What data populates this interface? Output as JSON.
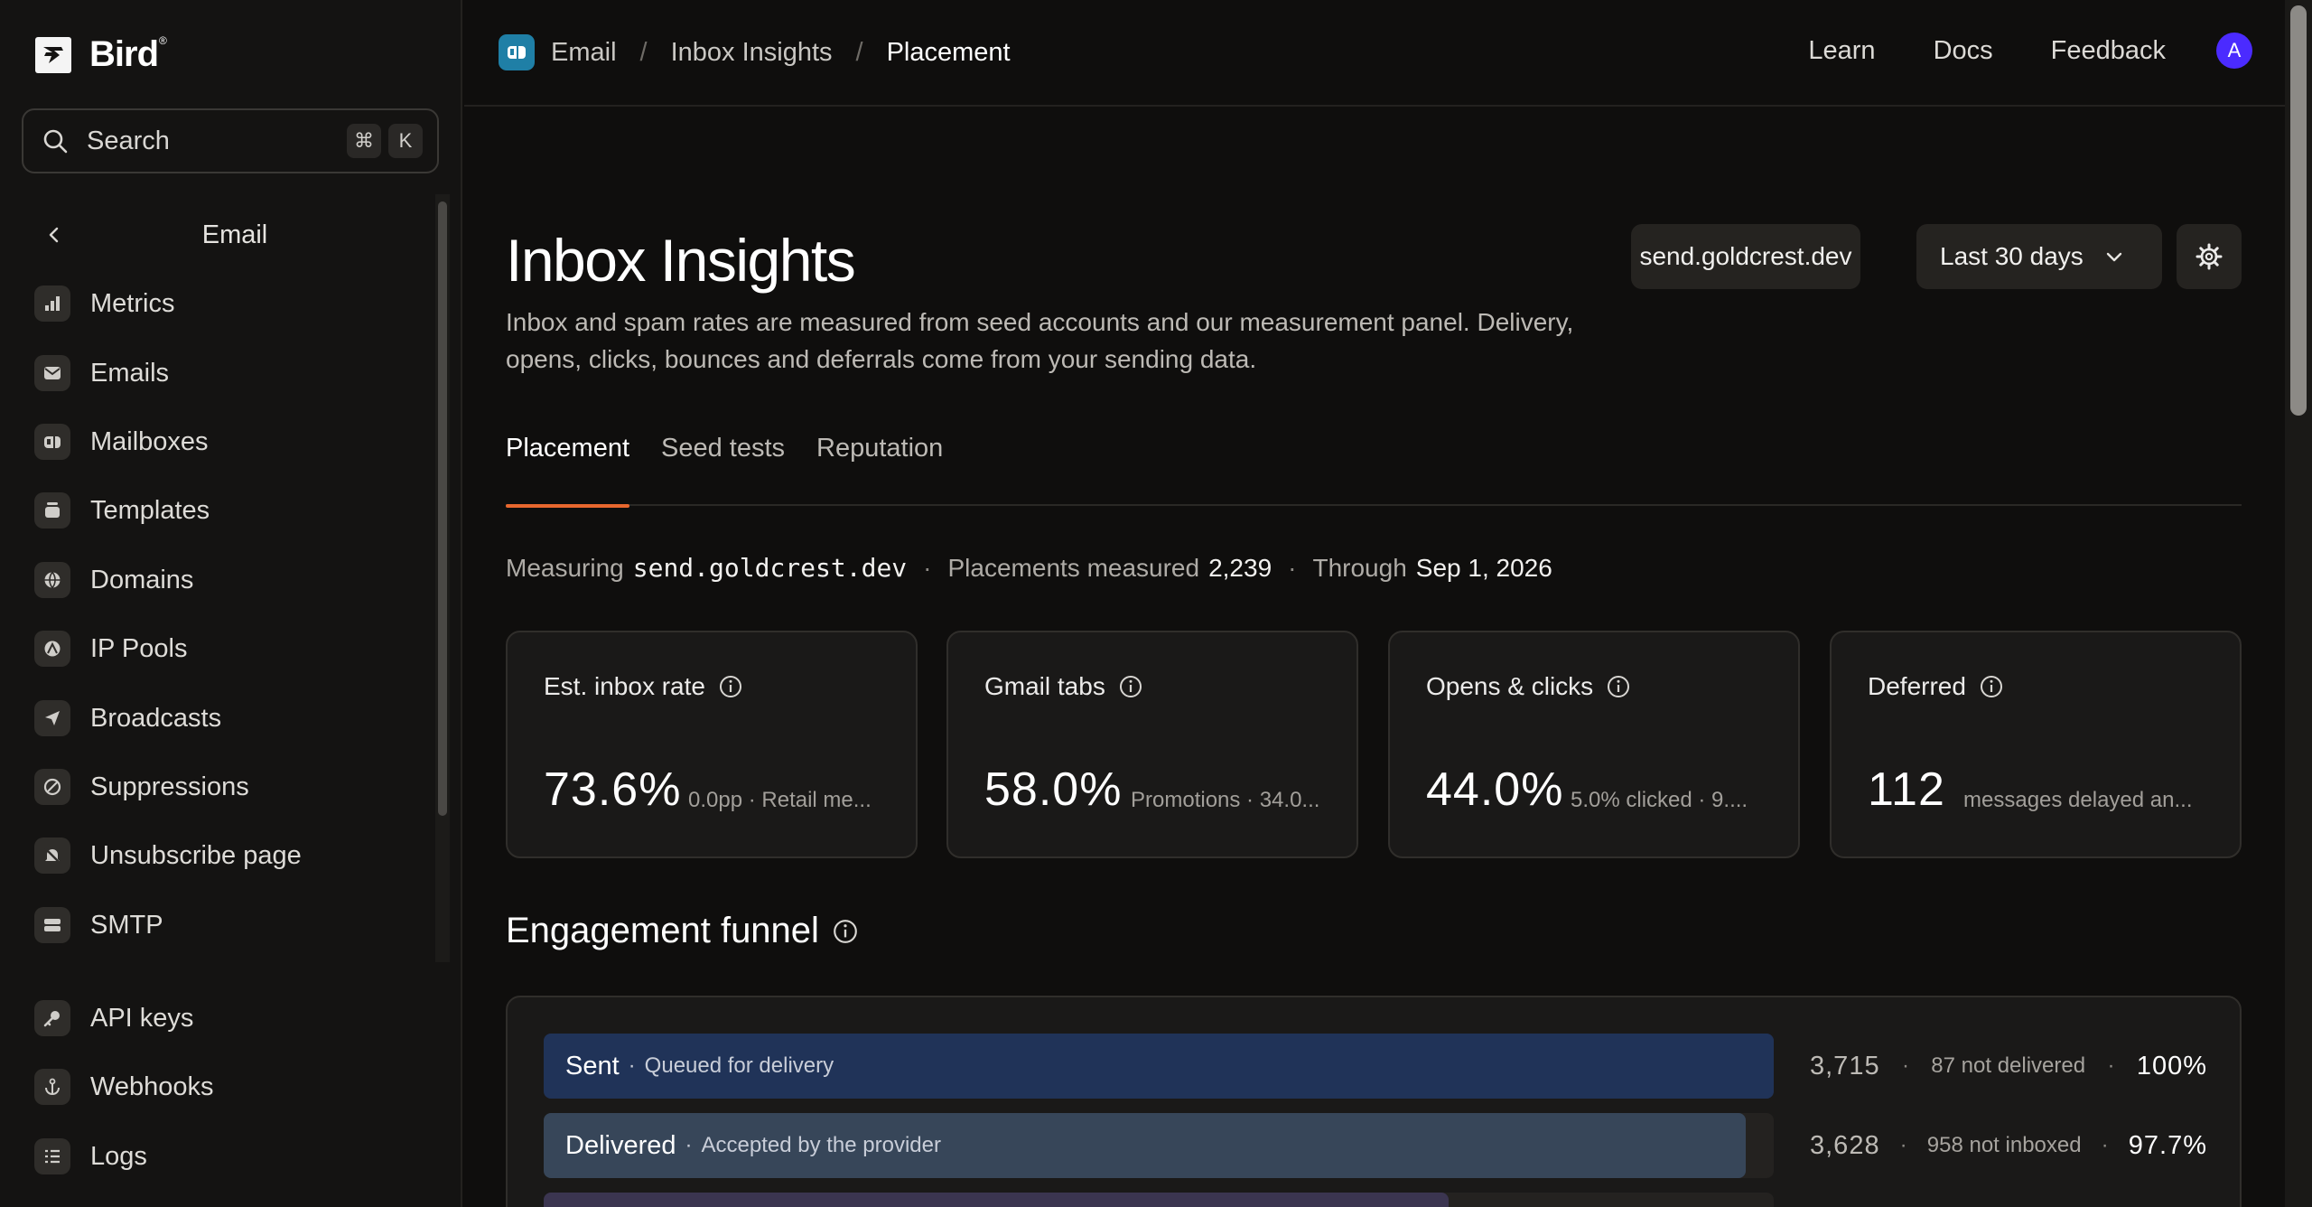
{
  "brand": {
    "name": "Bird",
    "mark": "®"
  },
  "search": {
    "label": "Search",
    "shortcut_mod": "⌘",
    "shortcut_key": "K"
  },
  "sidebar": {
    "back_label": "Email",
    "items": [
      {
        "label": "Metrics",
        "icon": "bar-chart-icon"
      },
      {
        "label": "Emails",
        "icon": "envelope-icon"
      },
      {
        "label": "Mailboxes",
        "icon": "mailbox-icon"
      },
      {
        "label": "Templates",
        "icon": "template-icon"
      },
      {
        "label": "Domains",
        "icon": "globe-icon"
      },
      {
        "label": "IP Pools",
        "icon": "ip-pool-icon"
      },
      {
        "label": "Broadcasts",
        "icon": "send-icon"
      },
      {
        "label": "Suppressions",
        "icon": "block-icon"
      },
      {
        "label": "Unsubscribe page",
        "icon": "bell-off-icon"
      },
      {
        "label": "SMTP",
        "icon": "server-icon"
      },
      {
        "label": "API keys",
        "icon": "key-icon"
      },
      {
        "label": "Webhooks",
        "icon": "anchor-icon"
      },
      {
        "label": "Logs",
        "icon": "list-icon"
      }
    ]
  },
  "breadcrumb": {
    "app": "Email",
    "section": "Inbox Insights",
    "current": "Placement",
    "separator": "/"
  },
  "topnav": {
    "learn": "Learn",
    "docs": "Docs",
    "feedback": "Feedback",
    "avatar_initial": "A"
  },
  "page": {
    "title": "Inbox Insights",
    "description": "Inbox and spam rates are measured from seed accounts and our measurement panel. Delivery, opens, clicks, bounces and deferrals come from your sending data.",
    "domain_selector": "send.goldcrest.dev",
    "date_range": "Last 30 days"
  },
  "tabs": [
    {
      "label": "Placement",
      "active": true
    },
    {
      "label": "Seed tests",
      "active": false
    },
    {
      "label": "Reputation",
      "active": false
    }
  ],
  "meta": {
    "measuring_label": "Measuring",
    "measuring_value": "send.goldcrest.dev",
    "placements_label": "Placements measured",
    "placements_value": "2,239",
    "through_label": "Through",
    "through_value": "Sep 1, 2026",
    "dot": "·"
  },
  "cards": [
    {
      "title": "Est. inbox rate",
      "value": "73.6%",
      "sub": "0.0pp · Retail me..."
    },
    {
      "title": "Gmail tabs",
      "value": "58.0%",
      "sub": "Promotions · 34.0..."
    },
    {
      "title": "Opens & clicks",
      "value": "44.0%",
      "sub": "5.0% clicked · 9...."
    },
    {
      "title": "Deferred",
      "value": "112",
      "sub": "messages delayed an..."
    }
  ],
  "funnel": {
    "title": "Engagement funnel",
    "rows": [
      {
        "name": "Sent",
        "desc": "Queued for delivery",
        "count": "3,715",
        "note": "87 not delivered",
        "pct": "100%",
        "fill": 1.0,
        "color": "#203358"
      },
      {
        "name": "Delivered",
        "desc": "Accepted by the provider",
        "count": "3,628",
        "note": "958 not inboxed",
        "pct": "97.7%",
        "fill": 0.977,
        "color": "#374659"
      },
      {
        "name": "",
        "desc": "",
        "count": "",
        "note": "",
        "pct": "",
        "fill": 0.736,
        "color": "#3b3550"
      }
    ]
  },
  "colors": {
    "accent": "#e8672e",
    "avatar": "#4b2bff",
    "app_icon": "#1f7fa6"
  }
}
